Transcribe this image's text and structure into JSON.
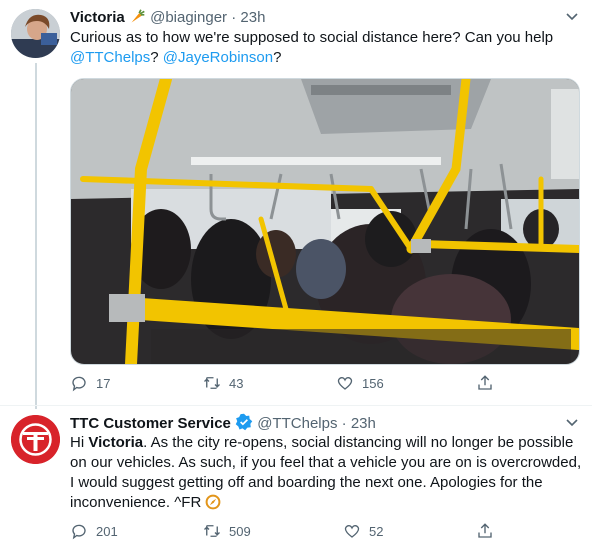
{
  "tweet1": {
    "name": "Victoria",
    "name_emoji": "carrot-emoji",
    "handle": "@biaginger",
    "dot": "·",
    "time": "23h",
    "text_line1": "Curious as to how we're supposed to social distance here? Can you help",
    "mention1": "@TTChelps",
    "qmark": "?",
    "mention2": "@JayeRobinson",
    "qmark2": "?",
    "image_alt": "Crowded bus interior with yellow handrails",
    "replies": "17",
    "retweets": "43",
    "likes": "156"
  },
  "tweet2": {
    "name": "TTC Customer Service",
    "handle": "@TTChelps",
    "dot": "·",
    "time": "23h",
    "text_hi": "Hi ",
    "text_name": "Victoria",
    "text_rest1": ". As the city re-opens, social distancing will no longer be possible",
    "text_line2": "on our vehicles. As such, if you feel that a vehicle you are on is overcrowded,",
    "text_line3": "I would suggest getting off and boarding the next one. Apologies for the",
    "text_line4": "inconvenience. ^FR",
    "replies": "201",
    "retweets": "509",
    "likes": "52"
  },
  "colors": {
    "ttc_red": "#d8232a",
    "link_blue": "#1d9bf0",
    "verified_blue": "#1d9bf0",
    "handrail_yellow": "#f2c400",
    "muted_text": "#536471"
  }
}
